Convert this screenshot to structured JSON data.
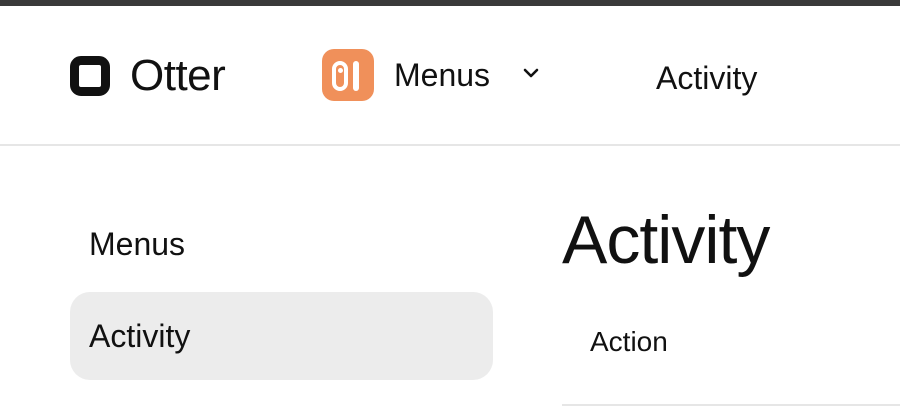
{
  "header": {
    "logo_text": "Otter",
    "app_switcher": {
      "label": "Menus",
      "icon": "app-tile-icon",
      "icon_color": "#f0905a",
      "chevron_icon": "chevron-down-icon"
    },
    "current_page": "Activity"
  },
  "sidebar": {
    "items": [
      {
        "label": "Menus",
        "active": false
      },
      {
        "label": "Activity",
        "active": true
      }
    ]
  },
  "main": {
    "title": "Activity",
    "table": {
      "columns": [
        "Action"
      ]
    }
  },
  "colors": {
    "top_bar": "#3a3a3a",
    "active_nav_bg": "#ececec",
    "divider": "#e6e6e6"
  }
}
